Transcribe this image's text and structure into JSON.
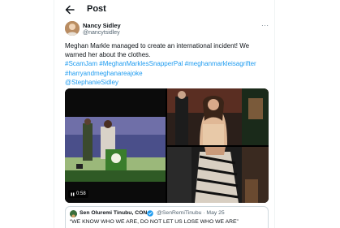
{
  "header": {
    "title": "Post"
  },
  "tweet": {
    "author": {
      "display_name": "Nancy Sidley",
      "handle": "@nancytsidley"
    },
    "more_label": "···",
    "text_plain": "Meghan Markle managed to create an international incident! We warned her about the clothes.",
    "hashtags": {
      "scamjam": "#ScamJam",
      "snapperpal": "#MeghanMarklesSnapperPal",
      "grifter": "#meghanmarkleisagrifter",
      "joke": "#harryandmeghanareajoke"
    },
    "mention": "@StephanieSidley",
    "media": {
      "video_duration": "0:58"
    }
  },
  "quote": {
    "display_name": "Sen Oluremi Tinubu, CON",
    "handle_date": "@SenRemiTinubu · May 25",
    "text": "“WE KNOW WHO WE ARE, DO NOT LET US LOSE WHO WE ARE”"
  },
  "colors": {
    "link": "#1d9bf0",
    "text": "#0f1419",
    "muted": "#536471",
    "border": "#cfd9de",
    "verified": "#1d9bf0"
  },
  "icons": {
    "back": "arrow-left-icon",
    "play": "play-icon",
    "verified": "verified-badge-icon"
  }
}
